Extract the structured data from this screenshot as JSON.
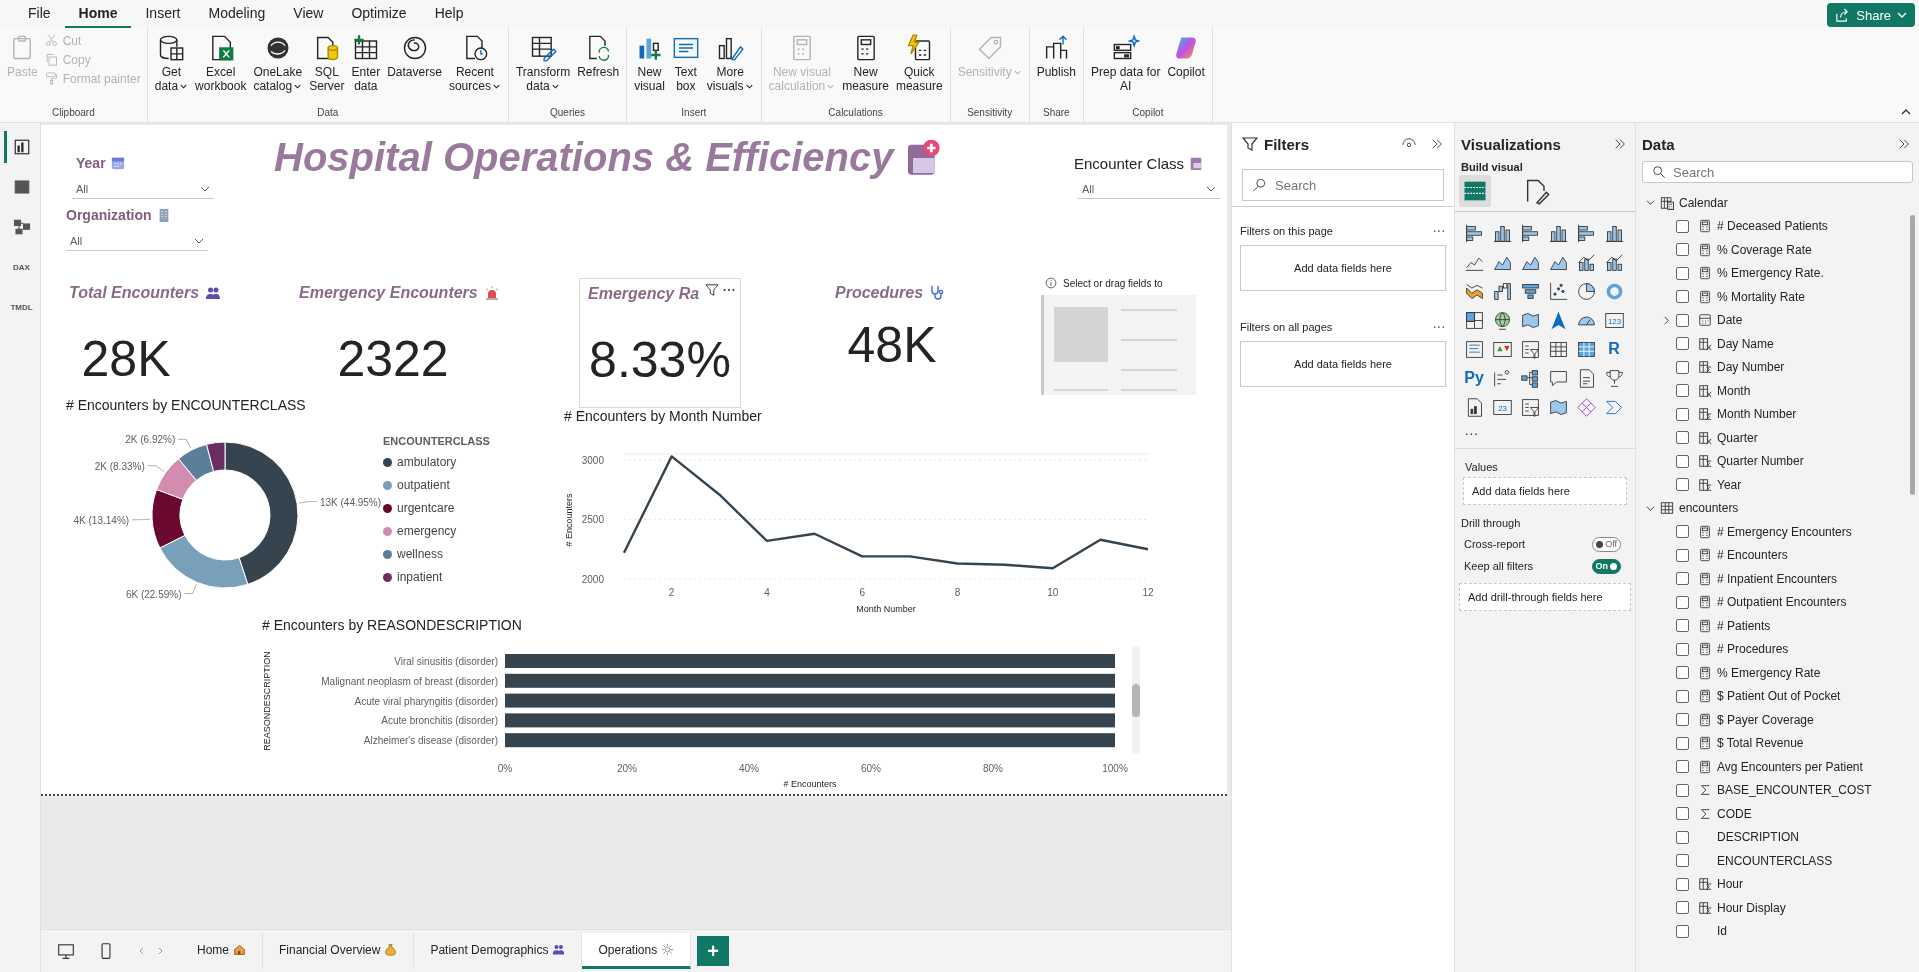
{
  "menu": {
    "tabs": [
      {
        "label": "File",
        "selected": false
      },
      {
        "label": "Home",
        "selected": true
      },
      {
        "label": "Insert",
        "selected": false
      },
      {
        "label": "Modeling",
        "selected": false
      },
      {
        "label": "View",
        "selected": false
      },
      {
        "label": "Optimize",
        "selected": false
      },
      {
        "label": "Help",
        "selected": false
      }
    ],
    "share": "Share"
  },
  "ribbon": {
    "groups": [
      {
        "label": "Clipboard",
        "buttons": [
          {
            "kind": "large",
            "lines": [
              "Paste"
            ],
            "dropdown": false,
            "disabled": true
          },
          {
            "kind": "small",
            "lines": [
              "Cut"
            ],
            "dropdown": false,
            "disabled": true
          },
          {
            "kind": "small",
            "lines": [
              "Copy"
            ],
            "dropdown": false,
            "disabled": true
          },
          {
            "kind": "small",
            "lines": [
              "Format painter"
            ],
            "dropdown": false,
            "disabled": true
          }
        ]
      },
      {
        "label": "Data",
        "buttons": [
          {
            "kind": "large",
            "lines": [
              "Get",
              "data"
            ],
            "dropdown": true,
            "disabled": false
          },
          {
            "kind": "large",
            "lines": [
              "Excel",
              "workbook"
            ],
            "dropdown": false,
            "disabled": false
          },
          {
            "kind": "large",
            "lines": [
              "OneLake",
              "catalog"
            ],
            "dropdown": true,
            "disabled": false
          },
          {
            "kind": "large",
            "lines": [
              "SQL",
              "Server"
            ],
            "dropdown": false,
            "disabled": false
          },
          {
            "kind": "large",
            "lines": [
              "Enter",
              "data"
            ],
            "dropdown": false,
            "disabled": false
          },
          {
            "kind": "large",
            "lines": [
              "Dataverse"
            ],
            "dropdown": false,
            "disabled": false
          },
          {
            "kind": "large",
            "lines": [
              "Recent",
              "sources"
            ],
            "dropdown": true,
            "disabled": false
          }
        ]
      },
      {
        "label": "Queries",
        "buttons": [
          {
            "kind": "large",
            "lines": [
              "Transform",
              "data"
            ],
            "dropdown": true,
            "disabled": false
          },
          {
            "kind": "large",
            "lines": [
              "Refresh"
            ],
            "dropdown": false,
            "disabled": false
          }
        ]
      },
      {
        "label": "Insert",
        "buttons": [
          {
            "kind": "large",
            "lines": [
              "New",
              "visual"
            ],
            "dropdown": false,
            "disabled": false
          },
          {
            "kind": "large",
            "lines": [
              "Text",
              "box"
            ],
            "dropdown": false,
            "disabled": false
          },
          {
            "kind": "large",
            "lines": [
              "More",
              "visuals"
            ],
            "dropdown": true,
            "disabled": false
          }
        ]
      },
      {
        "label": "Calculations",
        "buttons": [
          {
            "kind": "large",
            "lines": [
              "New visual",
              "calculation"
            ],
            "dropdown": true,
            "disabled": true
          },
          {
            "kind": "large",
            "lines": [
              "New",
              "measure"
            ],
            "dropdown": false,
            "disabled": false
          },
          {
            "kind": "large",
            "lines": [
              "Quick",
              "measure"
            ],
            "dropdown": false,
            "disabled": false
          }
        ]
      },
      {
        "label": "Sensitivity",
        "buttons": [
          {
            "kind": "large",
            "lines": [
              "Sensitivity"
            ],
            "dropdown": true,
            "disabled": true
          }
        ]
      },
      {
        "label": "Share",
        "buttons": [
          {
            "kind": "large",
            "lines": [
              "Publish"
            ],
            "dropdown": false,
            "disabled": false
          }
        ]
      },
      {
        "label": "Copilot",
        "buttons": [
          {
            "kind": "large",
            "lines": [
              "Prep data for",
              "AI"
            ],
            "dropdown": false,
            "disabled": false
          },
          {
            "kind": "large",
            "lines": [
              "Copilot"
            ],
            "dropdown": false,
            "disabled": false
          }
        ]
      }
    ]
  },
  "rail": [
    {
      "selected": true
    },
    {
      "selected": false
    },
    {
      "selected": false
    },
    {
      "selected": false,
      "label": "DAX"
    },
    {
      "selected": false,
      "label": "TMDL"
    }
  ],
  "report": {
    "title": "Hospital Operations & Efficiency",
    "slicers": [
      {
        "title": "Year",
        "value": "All"
      },
      {
        "title": "Organization",
        "value": "All"
      },
      {
        "title": "Encounter Class",
        "value": "All"
      }
    ],
    "cards": [
      {
        "title": "Total Encounters",
        "value": "28K",
        "hovered": false
      },
      {
        "title": "Emergency Encounters",
        "value": "2322",
        "hovered": false
      },
      {
        "title": "Emergency Ra",
        "value": "8.33%",
        "hovered": true
      },
      {
        "title": "Procedures",
        "value": "48K",
        "hovered": false
      }
    ],
    "empty_visual": {
      "hint": "Select or drag fields to"
    },
    "encounters_by_class": {
      "legend": {
        "title": "ENCOUNTERCLASS",
        "items": [
          {
            "color": "#35444f"
          },
          {
            "color": "#78a0ba"
          },
          {
            "color": "#6b0830"
          },
          {
            "color": "#d48bb0"
          },
          {
            "color": "#5b7f98"
          },
          {
            "color": "#6a2f62"
          }
        ]
      },
      "chart_data": {
        "type": "donut",
        "title": "# Encounters by ENCOUNTERCLASS",
        "categories": [
          "ambulatory",
          "outpatient",
          "urgentcare",
          "emergency",
          "wellness",
          "inpatient"
        ],
        "series": [
          {
            "values": [
              44.95,
              22.59,
              13.14,
              8.33,
              6.92,
              4.07
            ]
          }
        ],
        "value_labels": [
          "13K (44.95%)",
          "6K (22.59%)",
          "4K (13.14%)",
          "2K (8.33%)",
          "2K (6.92%)",
          null
        ]
      }
    },
    "encounters_by_month": {
      "chart_data": {
        "type": "line",
        "title": "# Encounters by Month Number",
        "xlabel": "Month Number",
        "ylabel": "# Encounters",
        "x": [
          1,
          2,
          3,
          4,
          5,
          6,
          7,
          8,
          9,
          10,
          11,
          12
        ],
        "series": [
          {
            "color": "#35444f",
            "values": [
              2220,
              3030,
              2710,
              2320,
              2380,
              2190,
              2190,
              2130,
              2120,
              2090,
              2330,
              2250
            ]
          }
        ],
        "xlim": [
          1,
          12
        ],
        "ylim": [
          2000,
          3050
        ],
        "xticks": [
          2,
          4,
          6,
          8,
          10,
          12
        ],
        "yticks": [
          2000,
          2500,
          3000
        ]
      }
    },
    "encounters_by_reason": {
      "chart_data": {
        "type": "bar",
        "orientation": "horizontal",
        "title": "# Encounters by REASONDESCRIPTION",
        "xlabel": "# Encounters",
        "ylabel": "REASONDESCRIPTION",
        "categories": [
          "Viral sinusitis (disorder)",
          "Malignant neoplasm of breast (disorder)",
          "Acute viral pharyngitis (disorder)",
          "Acute bronchitis (disorder)",
          "Alzheimer's disease (disorder)"
        ],
        "series": [
          {
            "color": "#35444f",
            "values": [
              100,
              100,
              100,
              100,
              100
            ]
          }
        ],
        "xlim": [
          0,
          100
        ],
        "xticks": [
          {
            "value": 0,
            "label": "0%"
          },
          {
            "value": 20,
            "label": "20%"
          },
          {
            "value": 40,
            "label": "40%"
          },
          {
            "value": 60,
            "label": "60%"
          },
          {
            "value": 80,
            "label": "80%"
          },
          {
            "value": 100,
            "label": "100%"
          }
        ]
      }
    }
  },
  "pages": {
    "tabs": [
      {
        "label": "Home",
        "selected": false
      },
      {
        "label": "Financial Overview",
        "selected": false
      },
      {
        "label": "Patient Demographics",
        "selected": false
      },
      {
        "label": "Operations",
        "selected": true
      }
    ],
    "add": "+"
  },
  "filters": {
    "title": "Filters",
    "search_placeholder": "Search",
    "sections": [
      {
        "title": "Filters on this page",
        "hint": "Add data fields here"
      },
      {
        "title": "Filters on all pages",
        "hint": "Add data fields here"
      }
    ]
  },
  "visualizations": {
    "title": "Visualizations",
    "subtitle": "Build visual",
    "modes": [
      {
        "selected": true
      },
      {
        "selected": false
      }
    ],
    "gallery": [
      {
        "kind": "hbar"
      },
      {
        "kind": "vbar"
      },
      {
        "kind": "hbar"
      },
      {
        "kind": "vbar"
      },
      {
        "kind": "hbar"
      },
      {
        "kind": "vbar"
      },
      {
        "kind": "line"
      },
      {
        "kind": "area"
      },
      {
        "kind": "area"
      },
      {
        "kind": "area"
      },
      {
        "kind": "combo"
      },
      {
        "kind": "combo"
      },
      {
        "kind": "ribbon"
      },
      {
        "kind": "waterfall"
      },
      {
        "kind": "funnel"
      },
      {
        "kind": "scatter"
      },
      {
        "kind": "pie"
      },
      {
        "kind": "donut"
      },
      {
        "kind": "treemap"
      },
      {
        "kind": "globe"
      },
      {
        "kind": "map"
      },
      {
        "kind": "arrow"
      },
      {
        "kind": "gauge"
      },
      {
        "kind": "card",
        "label": "123"
      },
      {
        "kind": "list"
      },
      {
        "kind": "kpi"
      },
      {
        "kind": "slicer"
      },
      {
        "kind": "table"
      },
      {
        "kind": "matrix"
      },
      {
        "kind": "script",
        "label": "R"
      },
      {
        "kind": "script",
        "label": "Py"
      },
      {
        "kind": "influencers"
      },
      {
        "kind": "tree"
      },
      {
        "kind": "bubble"
      },
      {
        "kind": "document"
      },
      {
        "kind": "trophy"
      },
      {
        "kind": "report"
      },
      {
        "kind": "card",
        "label": "23"
      },
      {
        "kind": "slicer"
      },
      {
        "kind": "map"
      },
      {
        "kind": "diamond"
      },
      {
        "kind": "chevrons"
      }
    ],
    "more": "...",
    "wells": [
      {
        "title": "Values",
        "hint": "Add data fields here"
      }
    ],
    "drill": {
      "title": "Drill through",
      "toggles": [
        {
          "label": "Cross-report",
          "on": false,
          "state": "Off"
        },
        {
          "label": "Keep all filters",
          "on": true,
          "state": "On"
        }
      ],
      "hint": "Add drill-through fields here"
    }
  },
  "data": {
    "title": "Data",
    "search_placeholder": "Search",
    "tables": [
      {
        "name": "Calendar",
        "kind": "calc-table",
        "expanded": true,
        "children": [
          {
            "label": "# Deceased Patients",
            "kind": "measure",
            "checked": false
          },
          {
            "label": "% Coverage Rate",
            "kind": "measure",
            "checked": false
          },
          {
            "label": "% Emergency Rate.",
            "kind": "measure",
            "checked": false
          },
          {
            "label": "% Mortality Rate",
            "kind": "measure",
            "checked": false
          },
          {
            "label": "Date",
            "kind": "date",
            "checked": false,
            "expanded": false
          },
          {
            "label": "Day Name",
            "kind": "calculated",
            "checked": false
          },
          {
            "label": "Day Number",
            "kind": "numeric-calculated",
            "checked": false
          },
          {
            "label": "Month",
            "kind": "calculated",
            "checked": false
          },
          {
            "label": "Month Number",
            "kind": "numeric-calculated",
            "checked": false
          },
          {
            "label": "Quarter",
            "kind": "calculated",
            "checked": false
          },
          {
            "label": "Quarter Number",
            "kind": "numeric-calculated",
            "checked": false
          },
          {
            "label": "Year",
            "kind": "numeric-calculated",
            "checked": false
          }
        ]
      },
      {
        "name": "encounters",
        "kind": "table",
        "expanded": true,
        "children": [
          {
            "label": "# Emergency Encounters",
            "kind": "measure",
            "checked": false
          },
          {
            "label": "# Encounters",
            "kind": "measure",
            "checked": false
          },
          {
            "label": "# Inpatient Encounters",
            "kind": "measure",
            "checked": false
          },
          {
            "label": "# Outpatient Encounters",
            "kind": "measure",
            "checked": false
          },
          {
            "label": "# Patients",
            "kind": "measure",
            "checked": false
          },
          {
            "label": "# Procedures",
            "kind": "measure",
            "checked": false
          },
          {
            "label": "% Emergency Rate",
            "kind": "measure",
            "checked": false
          },
          {
            "label": "$ Patient Out of Pocket",
            "kind": "measure",
            "checked": false
          },
          {
            "label": "$ Payer Coverage",
            "kind": "measure",
            "checked": false
          },
          {
            "label": "$ Total Revenue",
            "kind": "measure",
            "checked": false
          },
          {
            "label": "Avg Encounters per Patient",
            "kind": "measure",
            "checked": false
          },
          {
            "label": "BASE_ENCOUNTER_COST",
            "kind": "numeric",
            "checked": false
          },
          {
            "label": "CODE",
            "kind": "numeric",
            "checked": false
          },
          {
            "label": "DESCRIPTION",
            "kind": "text",
            "checked": false
          },
          {
            "label": "ENCOUNTERCLASS",
            "kind": "text",
            "checked": false
          },
          {
            "label": "Hour",
            "kind": "numeric-calculated",
            "checked": false
          },
          {
            "label": "Hour Display",
            "kind": "numeric-calculated",
            "checked": false
          },
          {
            "label": "Id",
            "kind": "text",
            "checked": false
          }
        ]
      }
    ]
  }
}
